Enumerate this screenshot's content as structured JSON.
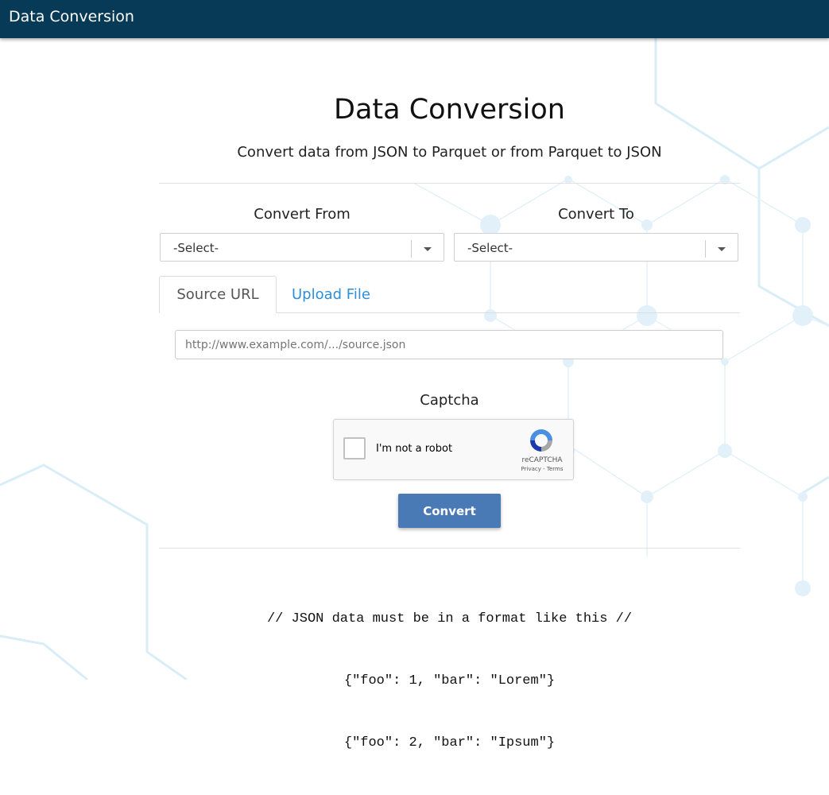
{
  "app": {
    "title": "Data Conversion"
  },
  "page": {
    "heading": "Data Conversion",
    "subtitle": "Convert data from JSON to Parquet or from Parquet to JSON"
  },
  "convert_from": {
    "label": "Convert From",
    "selected": "-Select-"
  },
  "convert_to": {
    "label": "Convert To",
    "selected": "-Select-"
  },
  "tabs": [
    {
      "label": "Source URL",
      "active": true
    },
    {
      "label": "Upload File",
      "active": false
    }
  ],
  "source_url": {
    "value": "",
    "placeholder": "http://www.example.com/.../source.json"
  },
  "captcha": {
    "label": "Captcha",
    "checkbox_label": "I'm not a robot",
    "brand": "reCAPTCHA",
    "links": "Privacy - Terms"
  },
  "convert_button": {
    "label": "Convert"
  },
  "code_example": {
    "lines": [
      "// JSON data must be in a format like this //",
      "{\"foo\": 1, \"bar\": \"Lorem\"}",
      "{\"foo\": 2, \"bar\": \"Ipsum\"}"
    ]
  },
  "colors": {
    "header_bg": "#063a56",
    "link": "#2f8fd6",
    "button_bg": "#4a7ab5",
    "background_pattern": "#d6ecf6"
  }
}
